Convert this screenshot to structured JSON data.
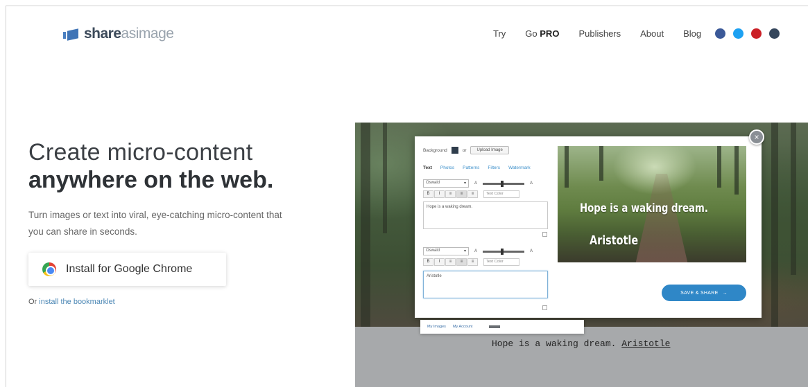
{
  "header": {
    "logo_bold": "share",
    "logo_thin": "asimage",
    "nav": [
      {
        "label": "Try"
      },
      {
        "label": "Go",
        "bold": "PRO"
      },
      {
        "label": "Publishers"
      },
      {
        "label": "About"
      },
      {
        "label": "Blog"
      }
    ],
    "social_colors": [
      "#3b5998",
      "#1da1f2",
      "#cb2027",
      "#35465c"
    ]
  },
  "hero": {
    "title_line1": "Create micro-content",
    "title_line2": "anywhere on the web.",
    "subtitle": "Turn images or text into viral, eye-catching micro-content that you can share in seconds.",
    "chrome_button": "Install for Google Chrome",
    "alt_prefix": "Or",
    "alt_link": "install the bookmarklet"
  },
  "demo": {
    "background_label": "Background",
    "or_label": "or",
    "upload_label": "Upload Image",
    "tabs": [
      "Text",
      "Photos",
      "Patterns",
      "Filters",
      "Watermark"
    ],
    "font1": "Oswald",
    "font2": "Oswald",
    "size_small": "A",
    "size_large": "A",
    "format_buttons": [
      "B",
      "I",
      "≡",
      "≡",
      "≡"
    ],
    "text_color_label": "Text Color",
    "quote_text": "Hope is a waking dream.",
    "author_text": "Aristotle",
    "save_label": "SAVE & SHARE",
    "save_arrow": "→",
    "close": "×",
    "my_images": "My Images",
    "my_account": "My Account",
    "dark_bar_label": "",
    "caption_quote": "Hope is a waking dream.",
    "caption_author": "Aristotle"
  }
}
